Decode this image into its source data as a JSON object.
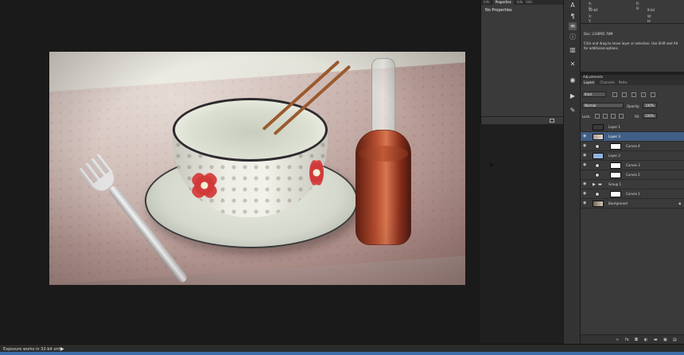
{
  "status": {
    "text": "Exposure works in 32-bit only",
    "menu_arrow": "▶"
  },
  "properties": {
    "tabs": [
      "Info",
      "Properties",
      "Info",
      "Info"
    ],
    "active_tab": "Properties",
    "title": "No Properties"
  },
  "info": {
    "cells": [
      "A:",
      "R:",
      "G:",
      "B:",
      "8-bit",
      "32-bit",
      "X:",
      "Y:",
      "W:",
      "H:"
    ],
    "doc": "Doc: 2.64M/5.78M",
    "message": "Click and drag to move layer or selection.  Use Shift and Alt for additional options."
  },
  "layers_panel": {
    "header": "Adjustments",
    "tabs": [
      "Layers",
      "Channels",
      "Paths"
    ],
    "active_tab": "Layers",
    "filter_kind": "Kind",
    "blend_mode": "Normal",
    "opacity_label": "Opacity:",
    "opacity_value": "100%",
    "lock_label": "Lock:",
    "fill_label": "Fill:",
    "fill_value": "100%",
    "layers": [
      {
        "name": "Layer 1",
        "visible": false,
        "type": "pixel-light",
        "selected": false
      },
      {
        "name": "Layer 3",
        "visible": true,
        "type": "pixel-photo",
        "selected": true
      },
      {
        "name": "Curves 4",
        "visible": true,
        "type": "adjustment",
        "selected": false
      },
      {
        "name": "Layer 2",
        "visible": true,
        "type": "pixel-blue",
        "selected": false
      },
      {
        "name": "Curves 3",
        "visible": true,
        "type": "adjustment",
        "selected": false
      },
      {
        "name": "Curves 2",
        "visible": false,
        "type": "adjustment",
        "selected": false
      },
      {
        "name": "Group 1",
        "visible": true,
        "type": "group",
        "selected": false
      },
      {
        "name": "Curves 1",
        "visible": true,
        "type": "adjustment",
        "selected": false
      },
      {
        "name": "Background",
        "visible": true,
        "type": "background",
        "selected": false
      }
    ],
    "footer_icons": [
      "link-icon",
      "fx-icon",
      "mask-icon",
      "adjustment-icon",
      "folder-icon",
      "new-layer-icon",
      "trash-icon"
    ]
  },
  "colors": {
    "selection": "#415e86",
    "panel_bg": "#3a3a3a",
    "canvas_bg": "#1a1a1a"
  }
}
